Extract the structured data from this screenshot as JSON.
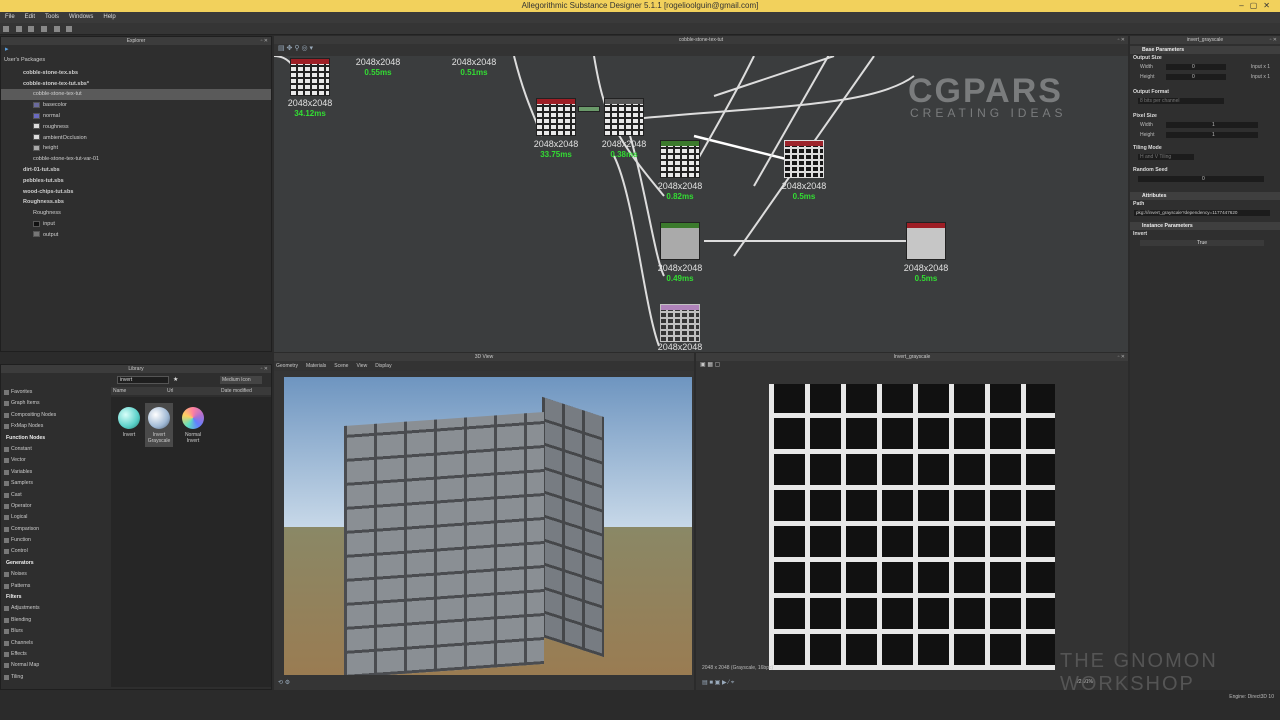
{
  "titlebar": {
    "title": "Allegorithmic Substance Designer 5.1.1 [rogelioolguin@gmail.com]"
  },
  "menu": [
    "File",
    "Edit",
    "Tools",
    "Windows",
    "Help"
  ],
  "explorer": {
    "title": "Explorer",
    "root": "User's Packages",
    "items": [
      {
        "label": "cobble-stone-tex.sbs",
        "bold": true
      },
      {
        "label": "cobble-stone-tex-tut.sbs*",
        "bold": true
      },
      {
        "label": "cobble-stone-tex-tut",
        "selected": true
      },
      {
        "label": "basecolor",
        "swatch": "#6a6a9c"
      },
      {
        "label": "normal",
        "swatch": "#6a6ac0"
      },
      {
        "label": "roughness",
        "swatch": "#dddddd"
      },
      {
        "label": "ambientOcclusion",
        "swatch": "#dddddd"
      },
      {
        "label": "height",
        "swatch": "#aaaaaa"
      },
      {
        "label": "cobble-stone-tex-tut-var-01"
      },
      {
        "label": "dirt-01-tut.sbs",
        "bold": true
      },
      {
        "label": "pebbles-tut.sbs",
        "bold": true
      },
      {
        "label": "wood-chips-tut.sbs",
        "bold": true
      },
      {
        "label": "Roughness.sbs",
        "bold": true
      },
      {
        "label": "Roughness"
      },
      {
        "label": "input",
        "swatch": "#111111"
      },
      {
        "label": "output",
        "swatch": "#777777"
      }
    ]
  },
  "library": {
    "title": "Library",
    "search": "invert",
    "view_mode": "Medium Icon",
    "sort": "Date modified",
    "col_name": "Name",
    "col_url": "Url",
    "categories": [
      {
        "label": "Favorites",
        "h": false
      },
      {
        "label": "Graph Items",
        "h": false
      },
      {
        "label": "Compositing Nodes",
        "h": false
      },
      {
        "label": "FxMap Nodes",
        "h": false
      },
      {
        "label": "Function Nodes",
        "h": true
      },
      {
        "label": "Constant",
        "h": false
      },
      {
        "label": "Vector",
        "h": false
      },
      {
        "label": "Variables",
        "h": false
      },
      {
        "label": "Samplers",
        "h": false
      },
      {
        "label": "Cast",
        "h": false
      },
      {
        "label": "Operator",
        "h": false
      },
      {
        "label": "Logical",
        "h": false
      },
      {
        "label": "Comparison",
        "h": false
      },
      {
        "label": "Function",
        "h": false
      },
      {
        "label": "Control",
        "h": false
      },
      {
        "label": "Generators",
        "h": true
      },
      {
        "label": "Noises",
        "h": false
      },
      {
        "label": "Patterns",
        "h": false
      },
      {
        "label": "Filters",
        "h": true
      },
      {
        "label": "Adjustments",
        "h": false
      },
      {
        "label": "Blending",
        "h": false
      },
      {
        "label": "Blurs",
        "h": false
      },
      {
        "label": "Channels",
        "h": false
      },
      {
        "label": "Effects",
        "h": false
      },
      {
        "label": "Normal Map",
        "h": false
      },
      {
        "label": "Tiling",
        "h": false
      }
    ],
    "items": [
      {
        "label": "Invert",
        "color": "#5ad0c8"
      },
      {
        "label": "Invert Grayscale",
        "color": "#9fb8d4"
      },
      {
        "label": "Normal Invert",
        "color": "#b070d0"
      }
    ]
  },
  "graph": {
    "title": "cobble-stone-tex-tut",
    "nodes": [
      {
        "res": "2048x2048",
        "time": "34.12ms"
      },
      {
        "res": "2048x2048",
        "time": "0.55ms"
      },
      {
        "res": "2048x2048",
        "time": "0.51ms"
      },
      {
        "res": "2048x2048",
        "time": "33.75ms"
      },
      {
        "res": "2048x2048",
        "time": "0.38ms"
      },
      {
        "res": "2048x2048",
        "time": "0.82ms"
      },
      {
        "res": "2048x2048",
        "time": "0.5ms"
      },
      {
        "res": "2048x2048",
        "time": "0.49ms"
      },
      {
        "res": "2048x2048",
        "time": "0.5ms"
      },
      {
        "res": "2048x2048",
        "time": ""
      }
    ],
    "watermark_line1": "CGPARS",
    "watermark_line2": "CREATING IDEAS"
  },
  "params": {
    "title": "invert_grayscale",
    "base_section": "Base Parameters",
    "output_size": "Output Size",
    "width": "Width",
    "height": "Height",
    "width_val": "0",
    "height_val": "0",
    "width_rel": "Input x 1",
    "height_rel": "Input x 1",
    "output_format": "Output Format",
    "output_format_val": "8 bits per channel",
    "pixel_size": "Pixel Size",
    "px_width": "Width",
    "px_height": "Height",
    "px_width_val": "1",
    "px_height_val": "1",
    "tiling_mode": "Tiling Mode",
    "tiling_val": "H and V Tiling",
    "random_seed": "Random Seed",
    "seed_val": "0",
    "attributes": "Attributes",
    "path_label": "Path",
    "path_val": "pkg:///invert_grayscale?dependency=1177447620",
    "instance_section": "Instance Parameters",
    "invert_label": "Invert",
    "invert_val": "True"
  },
  "view3d": {
    "title": "3D View",
    "menu": [
      "Geometry",
      "Materials",
      "Scene",
      "View",
      "Display"
    ]
  },
  "view2d": {
    "title": "Invert_grayscale",
    "info": "2048 x 2048 (Grayscale, 16bpc)",
    "zoom": "22.91%"
  },
  "status": {
    "engine": "Engine: Direct3D 10"
  },
  "brand": {
    "gnomon": "THE GNOMON WORKSHOP"
  }
}
